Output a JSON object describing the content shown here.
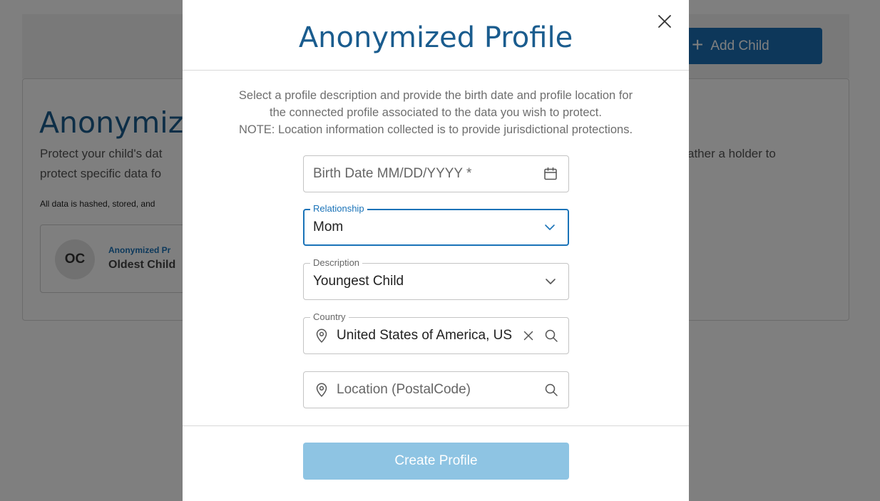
{
  "background": {
    "add_child_label": "Add Child",
    "page_title": "Anonymiz",
    "intro_line1": "Protect your child's dat",
    "intro_line2": "protect specific data fo",
    "intro_line1_right": "ather a holder to",
    "hash_note": "All data is hashed, stored, and",
    "profile_card": {
      "initials": "OC",
      "label": "Anonymized Pr",
      "name": "Oldest Child"
    }
  },
  "modal": {
    "title": "Anonymized Profile",
    "description": [
      "Select a profile description and provide the birth date and profile location for",
      "the connected profile associated to the data you wish to protect.",
      "NOTE: Location information collected is to provide jurisdictional protections."
    ],
    "birth_date": {
      "placeholder": "Birth Date MM/DD/YYYY *"
    },
    "relationship": {
      "label": "Relationship",
      "value": "Mom"
    },
    "description_field": {
      "label": "Description",
      "value": "Youngest Child"
    },
    "country": {
      "label": "Country",
      "value": "United States of America, US"
    },
    "location": {
      "placeholder": "Location (PostalCode)"
    },
    "create_button": "Create Profile"
  },
  "colors": {
    "brand": "#1a6fb5",
    "title": "#1a5c8e",
    "focus": "#1a73b8",
    "disabled_button": "#8ec4e3"
  }
}
